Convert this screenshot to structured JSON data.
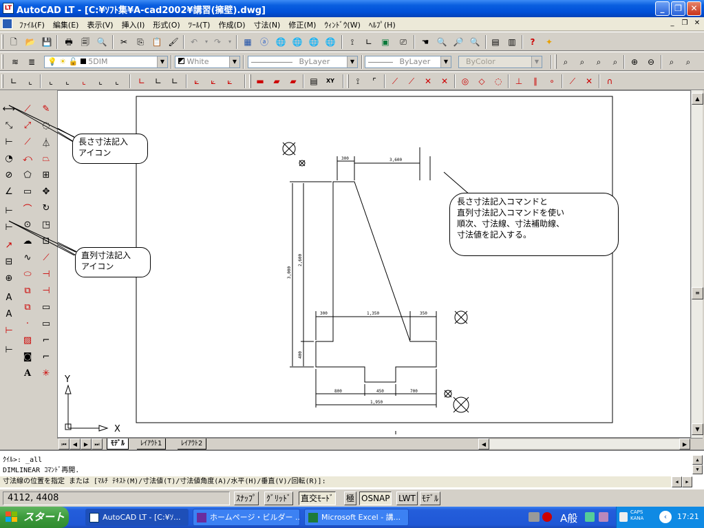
{
  "window": {
    "title": "AutoCAD LT - [C:¥ｿﾌﾄ集¥A-cad2002¥講習(擁壁).dwg]",
    "app_icon": "LT",
    "buttons": {
      "minimize": "_",
      "restore": "❐",
      "close": "✕"
    }
  },
  "menubar": {
    "items": [
      "ﾌｧｲﾙ(F)",
      "編集(E)",
      "表示(V)",
      "挿入(I)",
      "形式(O)",
      "ﾂｰﾙ(T)",
      "作成(D)",
      "寸法(N)",
      "修正(M)",
      "ｳｨﾝﾄﾞｳ(W)",
      "ﾍﾙﾌﾟ(H)"
    ],
    "mdi_buttons": [
      "_",
      "❐",
      "✕"
    ]
  },
  "properties": {
    "layer": "5DIM",
    "color": "White",
    "linetype": "ByLayer",
    "lineweight": "ByLayer",
    "plotstyle": "ByColor"
  },
  "drawing": {
    "annotations": {
      "dim_top": "300",
      "dim_top2": "3,600",
      "dim_left_total": "3,000",
      "dim_left_wall": "2,600",
      "dim_left_base": "400",
      "dim_mid_left": "300",
      "dim_mid": "1,350",
      "dim_mid_right": "350",
      "dim_bot_left": "800",
      "dim_bot_mid": "450",
      "dim_bot_right": "700",
      "dim_bot_total": "1,950"
    },
    "ucs": {
      "x": "X",
      "y": "Y"
    }
  },
  "callouts": {
    "length_dim": [
      "長さ寸法記入",
      "アイコン"
    ],
    "continue_dim": [
      "直列寸法記入",
      "アイコン"
    ],
    "explanation": [
      "長さ寸法記入コマンドと",
      "直列寸法記入コマンドを使い",
      "順次、寸法線、寸法補助線、",
      "寸法値を記入する。"
    ]
  },
  "layout_tabs": [
    "ﾓﾃﾞﾙ",
    "ﾚｲｱｳﾄ1",
    "ﾚｲｱｳﾄ2"
  ],
  "command_line": {
    "lines": [
      "ｸｲﾙ>:  _all",
      "DIMLINEAR ｺﾏﾝﾄﾞ再開."
    ],
    "prompt": "寸法線の位置を指定 または [ﾏﾙﾁ ﾃｷｽﾄ(M)/寸法値(T)/寸法値角度(A)/水平(H)/垂直(V)/回転(R)]:"
  },
  "statusbar": {
    "coords": "4112, 4408",
    "toggles": [
      "ｽﾅｯﾌﾟ",
      "ｸﾞﾘｯﾄﾞ",
      "直交ﾓｰﾄﾞ",
      "極",
      "OSNAP",
      "LWT",
      "ﾓﾃﾞﾙ"
    ]
  },
  "taskbar": {
    "start": "スタート",
    "tasks": [
      "AutoCAD LT - [C:¥ｿ...",
      "ホームページ・ビルダー ...",
      "Microsoft Excel - 講..."
    ],
    "ime": "A般",
    "caps": "CAPS",
    "kana": "KANA",
    "time": "17:21"
  },
  "colors": {
    "titlebar": "#0a5fe0",
    "drawing_bg": "#ffffff",
    "taskbar": "#245edb",
    "start": "#3c9b3c"
  }
}
